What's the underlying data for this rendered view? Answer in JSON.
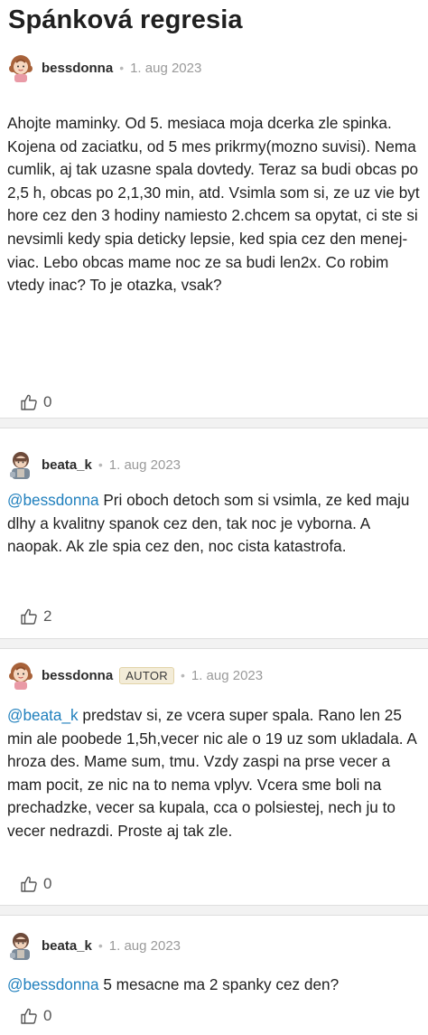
{
  "thread": {
    "title": "Spánková regresia"
  },
  "posts": [
    {
      "author": "bessdonna",
      "separator": "•",
      "date": "1. aug 2023",
      "mention": "",
      "text": "Ahojte maminky. Od 5. mesiaca moja dcerka zle spinka. Kojena od zaciatku, od 5 mes prikrmy(mozno suvisi). Nema cumlik, aj tak uzasne spala dovtedy. Teraz sa budi obcas po 2,5 h, obcas po 2,1,30 min, atd. Vsimla som si, ze uz vie byt hore cez den 3 hodiny namiesto 2.chcem sa opytat, ci ste si nevsimli kedy spia deticky lepsie, ked spia cez den menej-viac. Lebo obcas mame noc ze sa budi len2x. Co robim vtedy inac? To je otazka, vsak?",
      "likes": "0",
      "avatar": "girl-avatar-icon"
    },
    {
      "author": "beata_k",
      "separator": "•",
      "date": "1. aug 2023",
      "mention": "@bessdonna",
      "text": " Pri oboch detoch som si vsimla, ze ked maju dlhy a kvalitny spanok cez den, tak noc je vyborna. A naopak. Ak zle spia cez den, noc cista katastrofa.",
      "likes": "2",
      "avatar": "woman-avatar-icon"
    },
    {
      "author": "bessdonna",
      "badge": "AUTOR",
      "separator": "•",
      "date": "1. aug 2023",
      "mention": "@beata_k",
      "text": " predstav si, ze vcera super spala. Rano len 25 min ale poobede 1,5h,vecer nic ale o 19 uz som ukladala. A hroza des. Mame sum, tmu. Vzdy zaspi na prse vecer a mam pocit, ze nic na to nema vplyv. Vcera sme boli na prechadzke, vecer sa kupala, cca o polsiestej, nech ju to vecer nedrazdi. Proste aj tak zle.",
      "likes": "0",
      "avatar": "girl-avatar-icon"
    },
    {
      "author": "beata_k",
      "separator": "•",
      "date": "1. aug 2023",
      "mention": "@bessdonna",
      "text": " 5 mesacne ma 2 spanky cez den?",
      "likes": "0",
      "avatar": "woman-avatar-icon"
    }
  ],
  "colors": {
    "mention": "#1f7fbd",
    "badge_bg": "#f3ecd8",
    "divider": "#f2f2f2"
  }
}
